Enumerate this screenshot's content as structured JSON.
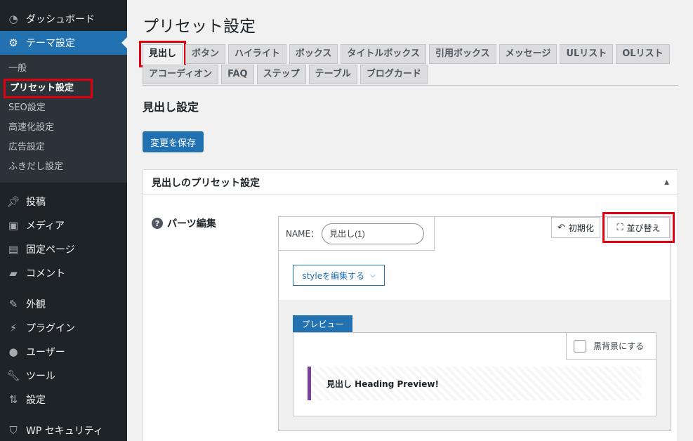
{
  "sidebar": {
    "top_items": [
      {
        "label": "ダッシュボード",
        "icon": "dashboard-icon"
      },
      {
        "label": "テーマ設定",
        "icon": "gear-icon"
      }
    ],
    "sub_items": [
      "一般",
      "プリセット設定",
      "SEO設定",
      "高速化設定",
      "広告設定",
      "ふきだし設定"
    ],
    "items": [
      {
        "label": "投稿",
        "icon": "pin-icon"
      },
      {
        "label": "メディア",
        "icon": "media-icon"
      },
      {
        "label": "固定ページ",
        "icon": "page-icon"
      },
      {
        "label": "コメント",
        "icon": "comment-icon"
      },
      {
        "label": "外観",
        "icon": "brush-icon"
      },
      {
        "label": "プラグイン",
        "icon": "plugin-icon"
      },
      {
        "label": "ユーザー",
        "icon": "user-icon"
      },
      {
        "label": "ツール",
        "icon": "wrench-icon"
      },
      {
        "label": "設定",
        "icon": "settings-icon"
      },
      {
        "label": "WP セキュリティ",
        "icon": "shield-icon"
      }
    ]
  },
  "page": {
    "title": "プリセット設定",
    "tabs_row1": [
      "見出し",
      "ボタン",
      "ハイライト",
      "ボックス",
      "タイトルボックス",
      "引用ボックス",
      "メッセージ",
      "ULリスト",
      "OLリスト"
    ],
    "tabs_row2": [
      "アコーディオン",
      "FAQ",
      "ステップ",
      "テーブル",
      "ブログカード"
    ],
    "section_title": "見出し設定",
    "save_label": "変更を保存"
  },
  "panel": {
    "title": "見出しのプリセット設定",
    "parts_label": "パーツ編集",
    "name_label": "NAME：",
    "name_value": "見出し(1)",
    "reset_label": "初期化",
    "sort_label": "並び替え",
    "style_label": "styleを編集する",
    "preview_label": "プレビュー",
    "dark_bg_label": "黒背景にする",
    "heading_preview": "見出し Heading Preview!",
    "accent_color": "#7b3f9e"
  }
}
